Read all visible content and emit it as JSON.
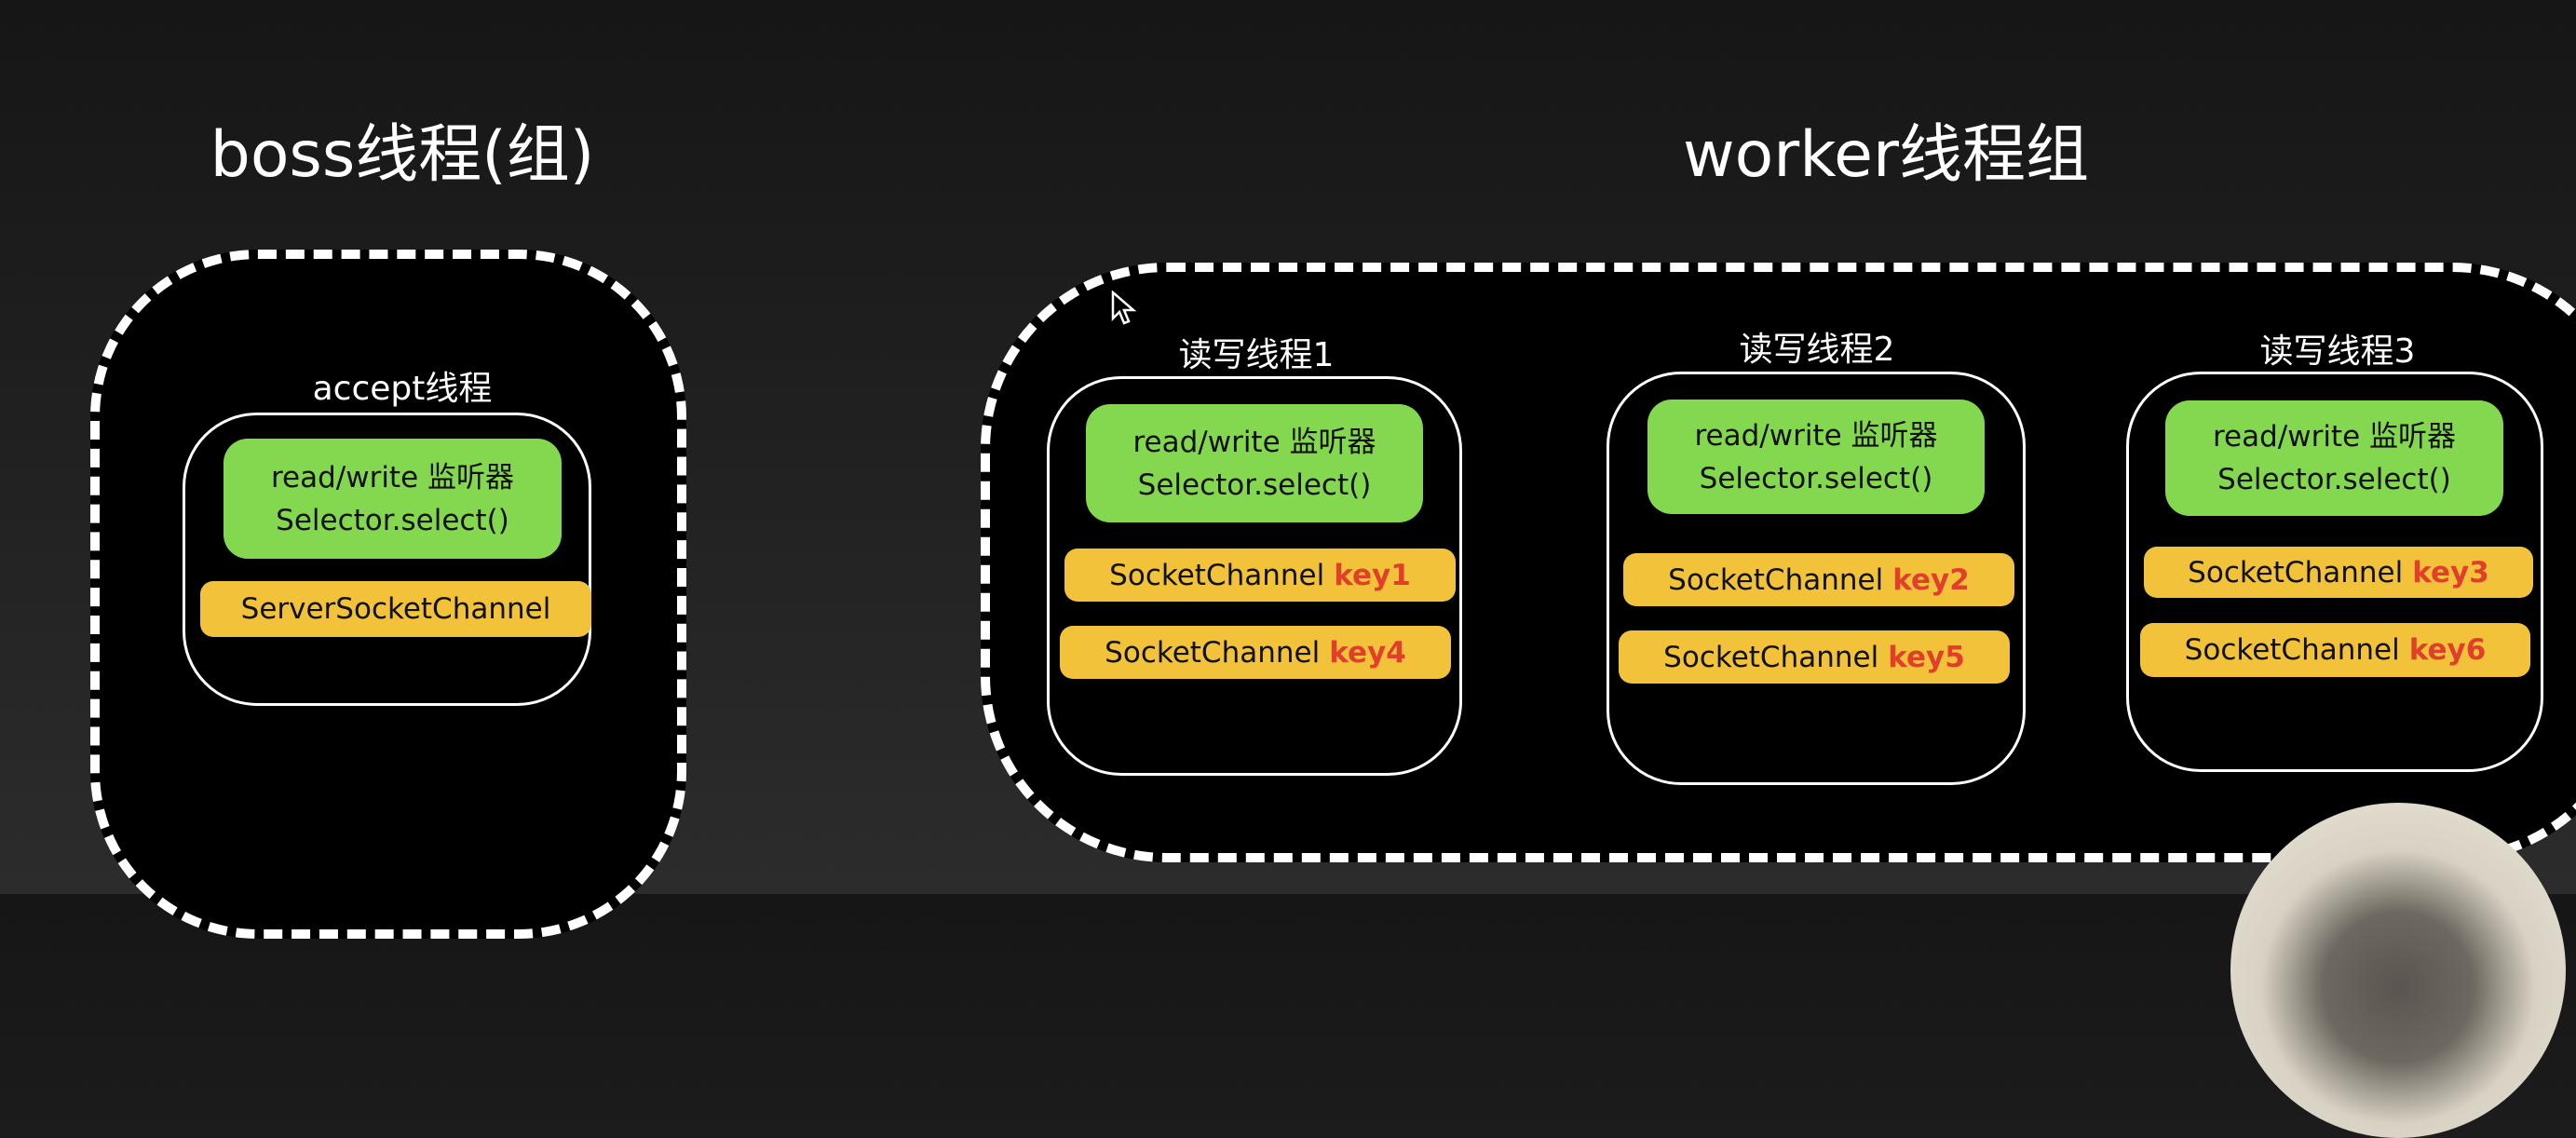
{
  "boss": {
    "title": "boss线程(组)",
    "thread_label": "accept线程",
    "listener_line1": "read/write 监听器",
    "listener_line2": "Selector.select()",
    "channel": "ServerSocketChannel"
  },
  "worker": {
    "title": "worker线程组",
    "threads": [
      {
        "label": "读写线程1",
        "listener_line1": "read/write 监听器",
        "listener_line2": "Selector.select()",
        "channels": [
          {
            "name": "SocketChannel",
            "key": "key1"
          },
          {
            "name": "SocketChannel",
            "key": "key4"
          }
        ]
      },
      {
        "label": "读写线程2",
        "listener_line1": "read/write 监听器",
        "listener_line2": "Selector.select()",
        "channels": [
          {
            "name": "SocketChannel",
            "key": "key2"
          },
          {
            "name": "SocketChannel",
            "key": "key5"
          }
        ]
      },
      {
        "label": "读写线程3",
        "listener_line1": "read/write 监听器",
        "listener_line2": "Selector.select()",
        "channels": [
          {
            "name": "SocketChannel",
            "key": "key3"
          },
          {
            "name": "SocketChannel",
            "key": "key6"
          }
        ]
      }
    ]
  },
  "colors": {
    "listener": "#84d84f",
    "channel": "#f1c23a",
    "key": "#e0402b",
    "background": "#000000"
  }
}
